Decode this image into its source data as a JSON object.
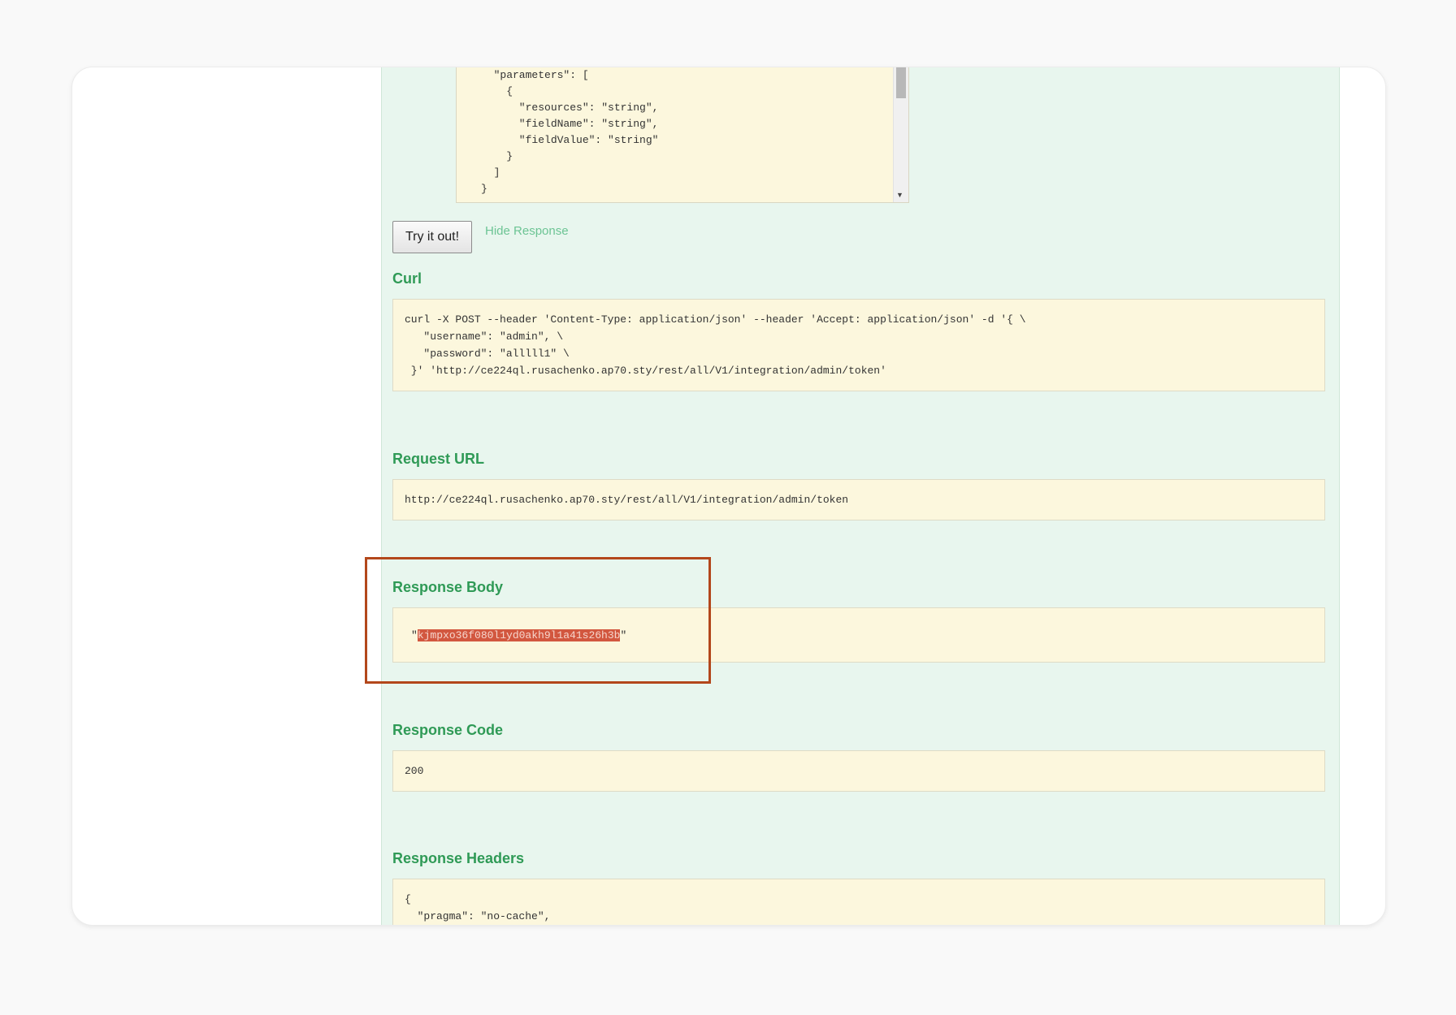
{
  "body_param": {
    "lines": [
      "  \"parameters\": [",
      "    {",
      "      \"resources\": \"string\",",
      "      \"fieldName\": \"string\",",
      "      \"fieldValue\": \"string\"",
      "    }",
      "  ]",
      "}"
    ]
  },
  "actions": {
    "try_button": "Try it out!",
    "hide_link": "Hide Response"
  },
  "curl": {
    "title": "Curl",
    "lines": [
      "curl -X POST --header 'Content-Type: application/json' --header 'Accept: application/json' -d '{ \\",
      "   \"username\": \"admin\", \\",
      "   \"password\": \"alllll1\" \\",
      " }' 'http://ce224ql.rusachenko.ap70.sty/rest/all/V1/integration/admin/token'"
    ]
  },
  "request_url": {
    "title": "Request URL",
    "value": "http://ce224ql.rusachenko.ap70.sty/rest/all/V1/integration/admin/token"
  },
  "response_body": {
    "title": "Response Body",
    "quote_open": "\"",
    "token": "kjmpxo36f080l1yd0akh9l1a41s26h3b",
    "quote_close": "\""
  },
  "response_code": {
    "title": "Response Code",
    "value": "200"
  },
  "response_headers": {
    "title": "Response Headers",
    "lines": [
      "{",
      "  \"pragma\": \"no-cache\","
    ]
  },
  "colors": {
    "panel_bg": "#e8f6ee",
    "code_bg": "#fcf7dd",
    "title_green": "#2f9a56",
    "callout": "#b3471b",
    "highlight": "#d2573f"
  }
}
